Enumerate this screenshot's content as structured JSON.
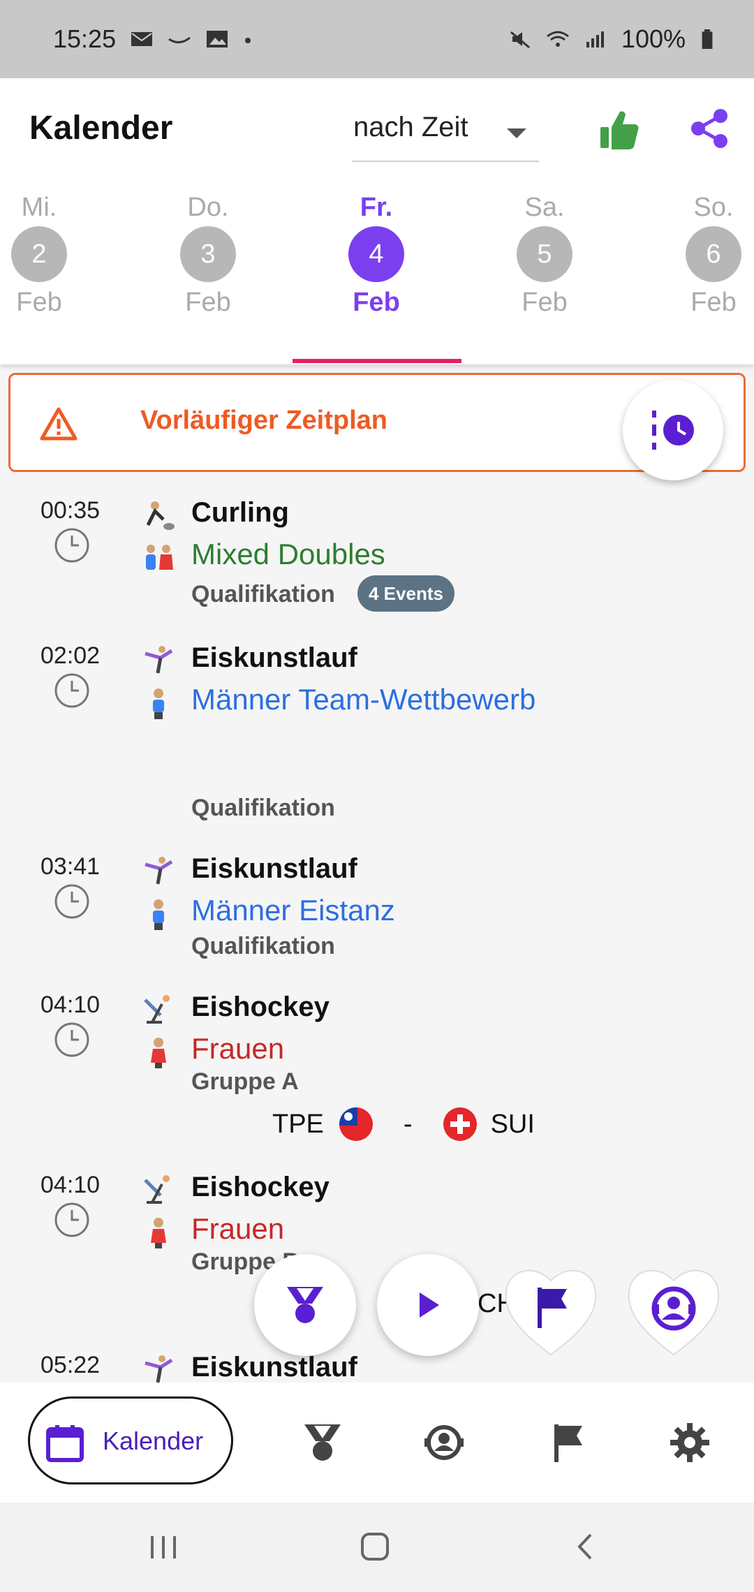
{
  "status_bar": {
    "time": "15:25",
    "battery": "100%"
  },
  "header": {
    "title": "Kalender",
    "sort": {
      "selected": "nach Zeit"
    }
  },
  "days": [
    {
      "name": "Mi.",
      "num": "2",
      "month": "Feb"
    },
    {
      "name": "Do.",
      "num": "3",
      "month": "Feb"
    },
    {
      "name": "Fr.",
      "num": "4",
      "month": "Feb"
    },
    {
      "name": "Sa.",
      "num": "5",
      "month": "Feb"
    },
    {
      "name": "So.",
      "num": "6",
      "month": "Feb"
    }
  ],
  "banner": {
    "text": "Vorläufiger Zeitplan"
  },
  "events": [
    {
      "time": "00:35",
      "sport": "Curling",
      "title": "Mixed Doubles",
      "sub": "Qualifikation",
      "badge": "4 Events"
    },
    {
      "time": "02:02",
      "sport": "Eiskunstlauf",
      "title": "Männer Team-Wettbewerb",
      "sub": "Qualifikation"
    },
    {
      "time": "03:41",
      "sport": "Eiskunstlauf",
      "title": "Männer Eistanz",
      "sub": "Qualifikation"
    },
    {
      "time": "04:10",
      "sport": "Eishockey",
      "title": "Frauen",
      "sub": "Gruppe A",
      "team1": "TPE",
      "separator": "-",
      "team2": "SUI"
    },
    {
      "time": "04:10",
      "sport": "Eishockey",
      "title": "Frauen",
      "sub": "Gruppe B",
      "team2_partial": "CH"
    },
    {
      "time": "05:22",
      "sport": "Eiskunstlauf"
    }
  ],
  "bottom_nav": {
    "active_label": "Kalender"
  },
  "colors": {
    "accent": "#7b3ff0",
    "nav_active": "#4a1fb8",
    "warning": "#ef5a23",
    "tab_indicator": "#e91e63"
  }
}
